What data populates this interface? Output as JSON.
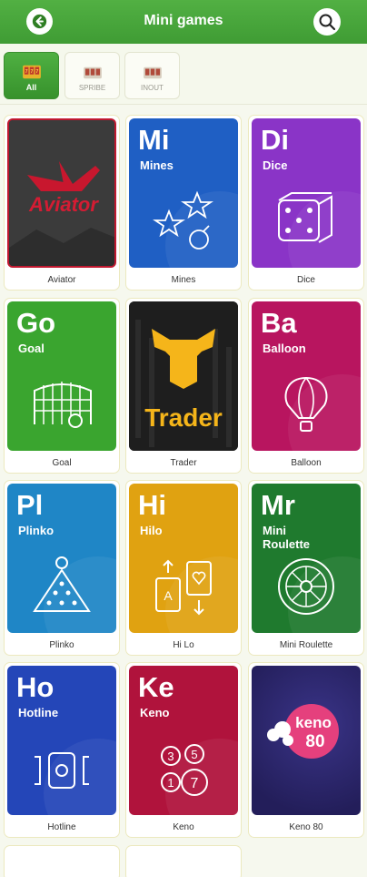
{
  "header": {
    "title": "Mini games",
    "back_icon": "back-arrow-icon",
    "search_icon": "search-icon"
  },
  "filters": [
    {
      "label": "All",
      "active": true
    },
    {
      "label": "SPRIBE",
      "active": false
    },
    {
      "label": "INOUT",
      "active": false
    }
  ],
  "games": [
    {
      "label": "Aviator",
      "logo_text": "Aviator",
      "color": "#3a3a3a"
    },
    {
      "label": "Mines",
      "abbr": "Mi",
      "name": "Mines",
      "color": "#1f5fc4"
    },
    {
      "label": "Dice",
      "abbr": "Di",
      "name": "Dice",
      "color": "#8a34c7"
    },
    {
      "label": "Goal",
      "abbr": "Go",
      "name": "Goal",
      "color": "#3aa52f"
    },
    {
      "label": "Trader",
      "logo_text": "Trader",
      "color": "#1d1d1d"
    },
    {
      "label": "Balloon",
      "abbr": "Ba",
      "name": "Balloon",
      "color": "#b8155f"
    },
    {
      "label": "Plinko",
      "abbr": "Pl",
      "name": "Plinko",
      "color": "#1f86c6"
    },
    {
      "label": "Hi Lo",
      "abbr": "Hi",
      "name": "Hilo",
      "color": "#e0a211"
    },
    {
      "label": "Mini Roulette",
      "abbr": "Mr",
      "name": "Mini Roulette",
      "color": "#1f7a2e"
    },
    {
      "label": "Hotline",
      "abbr": "Ho",
      "name": "Hotline",
      "color": "#2446b8"
    },
    {
      "label": "Keno",
      "abbr": "Ke",
      "name": "Keno",
      "color": "#b0133c"
    },
    {
      "label": "Keno 80",
      "logo_text": "keno",
      "logo_num": "80",
      "color": "#2e2770"
    }
  ]
}
